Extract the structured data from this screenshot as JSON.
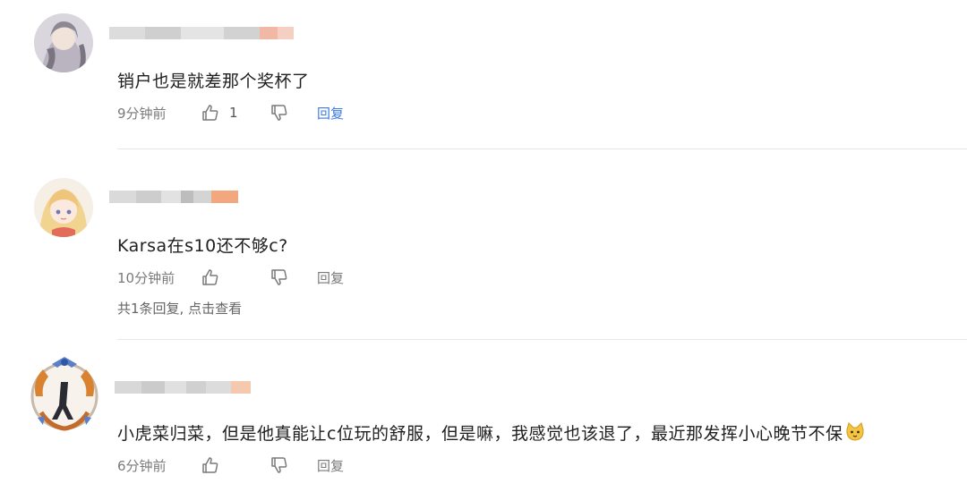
{
  "comments": [
    {
      "text": "销户也是就差那个奖杯了",
      "time": "9分钟前",
      "likes": "1",
      "reply_label": "回复",
      "reply_color": "#3d7be0"
    },
    {
      "text": "Karsa在s10还不够c?",
      "time": "10分钟前",
      "likes": "",
      "reply_label": "回复",
      "replies_link": "共1条回复, 点击查看"
    },
    {
      "text": "小虎菜归菜，但是他真能让c位玩的舒服，但是嘛，我感觉也该退了，最近那发挥小心晚节不保",
      "emoji": "cat-face-emoji",
      "time": "6分钟前",
      "likes": "",
      "reply_label": "回复"
    }
  ],
  "icons": {
    "like": "thumbs-up-icon",
    "dislike": "thumbs-down-icon"
  }
}
